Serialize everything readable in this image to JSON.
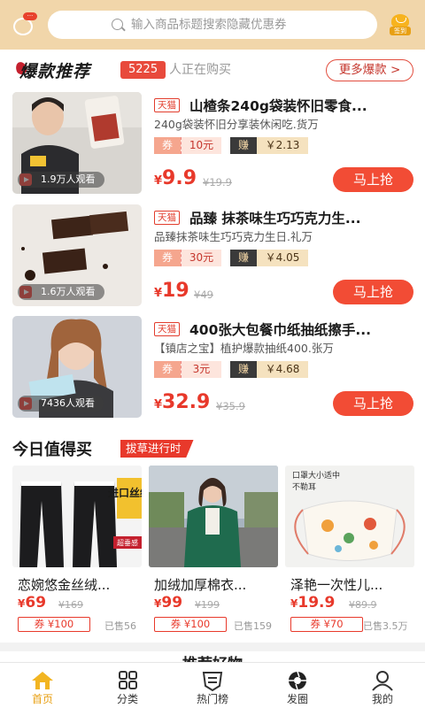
{
  "header": {
    "message_badge": "···",
    "search_placeholder": "输入商品标题搜索隐藏优惠券",
    "signin_label": "签到"
  },
  "hot": {
    "title": "爆款推荐",
    "count": "5225",
    "watching": "人正在购买",
    "more": "更多爆款 >",
    "items": [
      {
        "platform": "天猫",
        "title": "山楂条240g袋装怀旧零食...",
        "subtitle": "240g袋装怀旧分享装休闲吃.货万",
        "coupon_label": "券",
        "coupon_value": "10元",
        "earn_label": "赚",
        "earn_value": "￥2.13",
        "price_symbol": "¥",
        "price": "9.9",
        "original": "¥19.9",
        "views": "1.9万人观看",
        "buy": "马上抢"
      },
      {
        "platform": "天猫",
        "title": "品臻 抹茶味生巧巧克力生...",
        "subtitle": "品臻抹茶味生巧巧克力生日.礼万",
        "coupon_label": "券",
        "coupon_value": "30元",
        "earn_label": "赚",
        "earn_value": "￥4.05",
        "price_symbol": "¥",
        "price": "19",
        "original": "¥49",
        "views": "1.6万人观看",
        "buy": "马上抢"
      },
      {
        "platform": "天猫",
        "title": "400张大包餐巾纸抽纸擦手...",
        "subtitle": "【镇店之宝】植护爆款抽纸400.张万",
        "coupon_label": "券",
        "coupon_value": "3元",
        "earn_label": "赚",
        "earn_value": "￥4.68",
        "price_symbol": "¥",
        "price": "32.9",
        "original": "¥35.9",
        "views": "7436人观看",
        "buy": "马上抢"
      }
    ]
  },
  "today": {
    "title": "今日值得买",
    "tag": "拔草进行时",
    "items": [
      {
        "name": "恋婉悠金丝绒...",
        "price_symbol": "¥",
        "price": "69",
        "original": "¥169",
        "coupon": "券 ¥100",
        "sold": "已售56",
        "overlay_1": "进口丝绒",
        "overlay_2": "超垂感"
      },
      {
        "name": "加绒加厚棉衣...",
        "price_symbol": "¥",
        "price": "99",
        "original": "¥199",
        "coupon": "券 ¥100",
        "sold": "已售159"
      },
      {
        "name": "泽艳一次性儿...",
        "price_symbol": "¥",
        "price": "19.9",
        "original": "¥89.9",
        "coupon": "券 ¥70",
        "sold": "已售3.5万",
        "overlay_1": "口罩大小适中",
        "overlay_2": "不勒耳"
      }
    ]
  },
  "recommend": {
    "title": "推荐好物"
  },
  "tabs": [
    {
      "label": "首页",
      "icon": "home-icon",
      "active": true
    },
    {
      "label": "分类",
      "icon": "category-grid-icon"
    },
    {
      "label": "热门榜",
      "icon": "hot-list-icon"
    },
    {
      "label": "发圈",
      "icon": "camera-shutter-icon"
    },
    {
      "label": "我的",
      "icon": "user-icon"
    }
  ],
  "colors": {
    "header_bg": "#f1d6aa",
    "accent_red": "#e8392b",
    "tab_active": "#e8a014"
  }
}
